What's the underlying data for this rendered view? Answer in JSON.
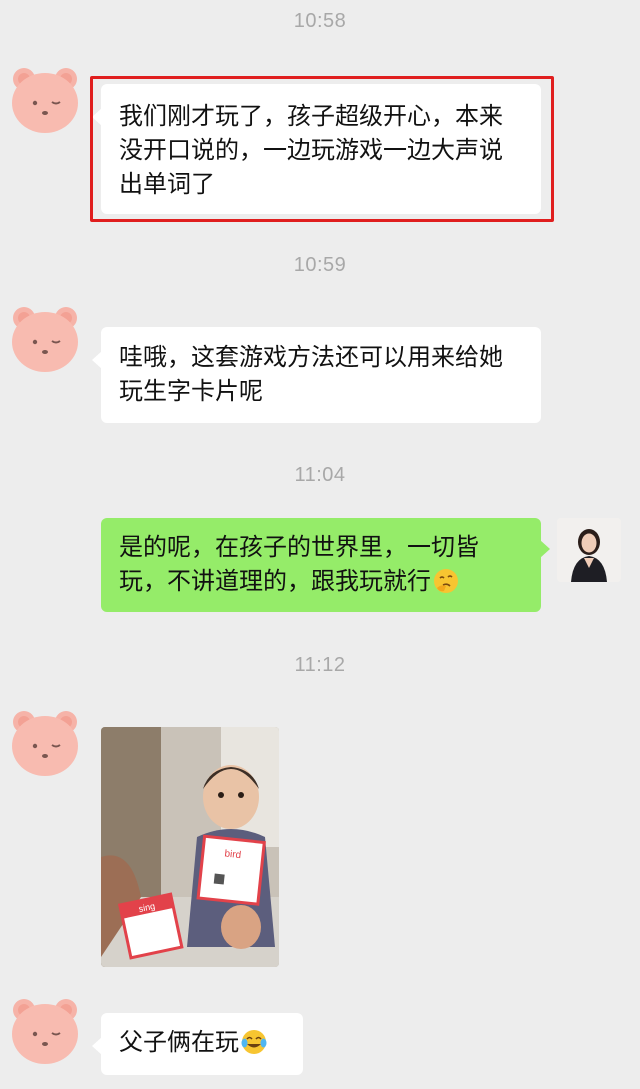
{
  "messages": [
    {
      "time": "10:58",
      "sender": "other",
      "text": "我们刚才玩了，孩子超级开心，本来没开口说的，一边玩游戏一边大声说出单词了"
    },
    {
      "time": "10:59",
      "sender": "other",
      "text": "哇哦，这套游戏方法还可以用来给她玩生字卡片呢"
    },
    {
      "time": "11:04",
      "sender": "self",
      "text": "是的呢，在孩子的世界里，一切皆玩，不讲道理的，跟我玩就行",
      "emoji": "thinking-face"
    },
    {
      "time": "11:12",
      "sender": "other",
      "photo": {
        "card_front": "bird",
        "card_back": "sing"
      }
    },
    {
      "sender": "other",
      "text": "父子俩在玩",
      "emoji": "tears-of-joy-face"
    }
  ],
  "colors": {
    "background": "#ededed",
    "self_bubble": "#95ec69",
    "other_bubble": "#ffffff",
    "highlight_box": "#e01e1e",
    "timestamp": "#a8a8a8"
  }
}
